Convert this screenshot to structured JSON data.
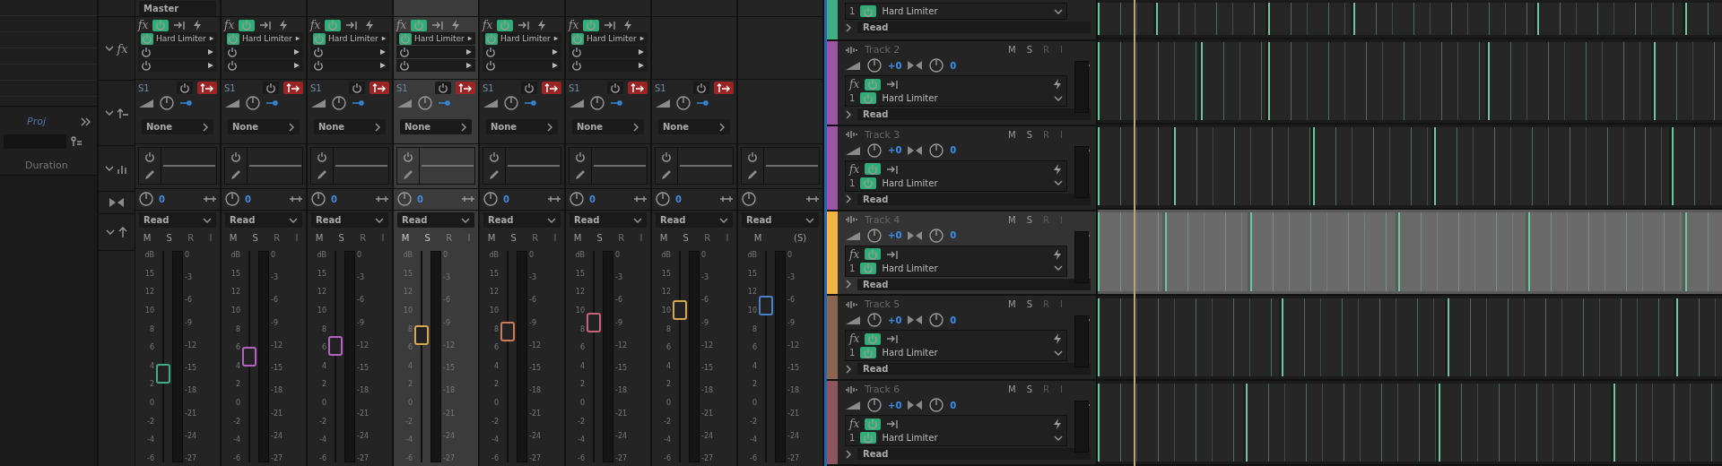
{
  "left_panel": {
    "tab": "Proj",
    "column": "Duration"
  },
  "mixer": {
    "fx_label": "fx",
    "channels": [
      {
        "output": "Master",
        "fx_label": "fx",
        "effect": "Hard Limiter",
        "send": "S1",
        "send_output": "None",
        "pan": "0",
        "automation": "Read",
        "selected": false,
        "color": "#3fae86",
        "level": 0.42,
        "buttons": [
          {
            "label": "M",
            "disabled": false
          },
          {
            "label": "S",
            "disabled": false
          },
          {
            "label": "R",
            "disabled": true
          },
          {
            "label": "I",
            "disabled": true
          }
        ],
        "fader_scale": [
          "dB",
          "15",
          "12",
          "10",
          "8",
          "6",
          "4",
          "2",
          "0",
          "-2",
          "-4",
          "-6"
        ],
        "meter_scale": [
          "0",
          "-3",
          "-6",
          "-9",
          "-12",
          "-15",
          "-18",
          "-21",
          "-24",
          "-27"
        ]
      },
      {
        "fx_label": "fx",
        "effect": "Hard Limiter",
        "send": "S1",
        "send_output": "None",
        "pan": "0",
        "automation": "Read",
        "selected": false,
        "color": "#b562c4",
        "level": 0.5,
        "buttons": [
          {
            "label": "M",
            "disabled": false
          },
          {
            "label": "S",
            "disabled": false
          },
          {
            "label": "R",
            "disabled": true
          },
          {
            "label": "I",
            "disabled": true
          }
        ],
        "fader_scale": [
          "dB",
          "15",
          "12",
          "10",
          "8",
          "6",
          "4",
          "2",
          "0",
          "-2",
          "-4",
          "-6"
        ],
        "meter_scale": [
          "0",
          "-3",
          "-6",
          "-9",
          "-12",
          "-15",
          "-18",
          "-21",
          "-24",
          "-27"
        ]
      },
      {
        "fx_label": "fx",
        "effect": "Hard Limiter",
        "send": "S1",
        "send_output": "None",
        "pan": "0",
        "automation": "Read",
        "selected": false,
        "color": "#b562c4",
        "level": 0.55,
        "buttons": [
          {
            "label": "M",
            "disabled": false
          },
          {
            "label": "S",
            "disabled": false
          },
          {
            "label": "R",
            "disabled": true
          },
          {
            "label": "I",
            "disabled": true
          }
        ],
        "fader_scale": [
          "dB",
          "15",
          "12",
          "10",
          "8",
          "6",
          "4",
          "2",
          "0",
          "-2",
          "-4",
          "-6"
        ],
        "meter_scale": [
          "0",
          "-3",
          "-6",
          "-9",
          "-12",
          "-15",
          "-18",
          "-21",
          "-24",
          "-27"
        ]
      },
      {
        "fx_label": "fx",
        "effect": "Hard Limiter",
        "send": "S1",
        "send_output": "None",
        "pan": "0",
        "automation": "Read",
        "selected": true,
        "color": "#d8a851",
        "level": 0.6,
        "buttons": [
          {
            "label": "M",
            "disabled": false
          },
          {
            "label": "S",
            "disabled": false
          },
          {
            "label": "R",
            "disabled": true
          },
          {
            "label": "I",
            "disabled": true
          }
        ],
        "fader_scale": [
          "dB",
          "15",
          "12",
          "10",
          "8",
          "6",
          "4",
          "2",
          "0",
          "-2",
          "-4",
          "-6"
        ],
        "meter_scale": [
          "0",
          "-3",
          "-6",
          "-9",
          "-12",
          "-15",
          "-18",
          "-21",
          "-24",
          "-27"
        ]
      },
      {
        "fx_label": "fx",
        "effect": "Hard Limiter",
        "send": "S1",
        "send_output": "None",
        "pan": "0",
        "automation": "Read",
        "selected": false,
        "color": "#d07a58",
        "level": 0.62,
        "buttons": [
          {
            "label": "M",
            "disabled": false
          },
          {
            "label": "S",
            "disabled": false
          },
          {
            "label": "R",
            "disabled": true
          },
          {
            "label": "I",
            "disabled": true
          }
        ],
        "fader_scale": [
          "dB",
          "15",
          "12",
          "10",
          "8",
          "6",
          "4",
          "2",
          "0",
          "-2",
          "-4",
          "-6"
        ],
        "meter_scale": [
          "0",
          "-3",
          "-6",
          "-9",
          "-12",
          "-15",
          "-18",
          "-21",
          "-24",
          "-27"
        ]
      },
      {
        "fx_label": "fx",
        "effect": "Hard Limiter",
        "send": "S1",
        "send_output": "None",
        "pan": "0",
        "automation": "Read",
        "selected": false,
        "color": "#d0607a",
        "level": 0.66,
        "buttons": [
          {
            "label": "M",
            "disabled": false
          },
          {
            "label": "S",
            "disabled": false
          },
          {
            "label": "R",
            "disabled": true
          },
          {
            "label": "I",
            "disabled": true
          }
        ],
        "fader_scale": [
          "dB",
          "15",
          "12",
          "10",
          "8",
          "6",
          "4",
          "2",
          "0",
          "-2",
          "-4",
          "-6"
        ],
        "meter_scale": [
          "0",
          "-3",
          "-6",
          "-9",
          "-12",
          "-15",
          "-18",
          "-21",
          "-24",
          "-27"
        ]
      },
      {
        "send": "S1",
        "send_output": "None",
        "pan": "0",
        "automation": "Read",
        "selected": false,
        "color": "#d8a851",
        "level": 0.72,
        "buttons": [
          {
            "label": "M",
            "disabled": false
          },
          {
            "label": "S",
            "disabled": false
          },
          {
            "label": "R",
            "disabled": true
          },
          {
            "label": "I",
            "disabled": true
          }
        ],
        "fader_scale": [
          "dB",
          "15",
          "12",
          "10",
          "8",
          "6",
          "4",
          "2",
          "0",
          "-2",
          "-4",
          "-6"
        ],
        "meter_scale": [
          "0",
          "-3",
          "-6",
          "-9",
          "-12",
          "-15",
          "-18",
          "-21",
          "-24",
          "-27"
        ]
      },
      {
        "automation": "Read",
        "selected": false,
        "color": "#4a7fd0",
        "level": 0.74,
        "buttons": [
          {
            "label": "M",
            "disabled": false
          },
          {
            "label": "(S)",
            "disabled": false
          }
        ],
        "fader_scale": [
          "dB",
          "15",
          "12",
          "10",
          "8",
          "6",
          "4",
          "2",
          "0",
          "-2",
          "-4",
          "-6"
        ],
        "meter_scale": [
          "0",
          "-3",
          "-6",
          "-9",
          "-12",
          "-15",
          "-18",
          "-21",
          "-24",
          "-27"
        ]
      }
    ]
  },
  "tracks": [
    {
      "color": "#3fae86",
      "selected": false,
      "slot": "1",
      "effect": "Hard Limiter",
      "automation": "Read"
    },
    {
      "name": "Track 2",
      "color": "#9a55a3",
      "selected": false,
      "buttons": [
        {
          "label": "M",
          "disabled": false
        },
        {
          "label": "S",
          "disabled": false
        },
        {
          "label": "R",
          "disabled": true
        },
        {
          "label": "I",
          "disabled": true
        }
      ],
      "volume": "+0",
      "pan": "0",
      "fx_label": "fx",
      "slot": "1",
      "effect": "Hard Limiter",
      "automation": "Read"
    },
    {
      "name": "Track 3",
      "color": "#9a55a3",
      "selected": false,
      "buttons": [
        {
          "label": "M",
          "disabled": false
        },
        {
          "label": "S",
          "disabled": false
        },
        {
          "label": "R",
          "disabled": true
        },
        {
          "label": "I",
          "disabled": true
        }
      ],
      "volume": "+0",
      "pan": "0",
      "fx_label": "fx",
      "slot": "1",
      "effect": "Hard Limiter",
      "automation": "Read"
    },
    {
      "name": "Track 4",
      "color": "#f0b545",
      "selected": true,
      "buttons": [
        {
          "label": "M",
          "disabled": false
        },
        {
          "label": "S",
          "disabled": false
        },
        {
          "label": "R",
          "disabled": true
        },
        {
          "label": "I",
          "disabled": true
        }
      ],
      "volume": "+0",
      "pan": "0",
      "fx_label": "fx",
      "slot": "1",
      "effect": "Hard Limiter",
      "automation": "Read"
    },
    {
      "name": "Track 5",
      "color": "#8a6552",
      "selected": false,
      "buttons": [
        {
          "label": "M",
          "disabled": false
        },
        {
          "label": "S",
          "disabled": false
        },
        {
          "label": "R",
          "disabled": true
        },
        {
          "label": "I",
          "disabled": true
        }
      ],
      "volume": "+0",
      "pan": "0",
      "fx_label": "fx",
      "slot": "1",
      "effect": "Hard Limiter",
      "automation": "Read"
    },
    {
      "name": "Track 6",
      "color": "#8c5560",
      "selected": false,
      "buttons": [
        {
          "label": "M",
          "disabled": false
        },
        {
          "label": "S",
          "disabled": false
        },
        {
          "label": "R",
          "disabled": true
        },
        {
          "label": "I",
          "disabled": true
        }
      ],
      "volume": "+0",
      "pan": "0",
      "fx_label": "fx",
      "slot": "1",
      "effect": "Hard Limiter",
      "automation": "Read"
    }
  ]
}
